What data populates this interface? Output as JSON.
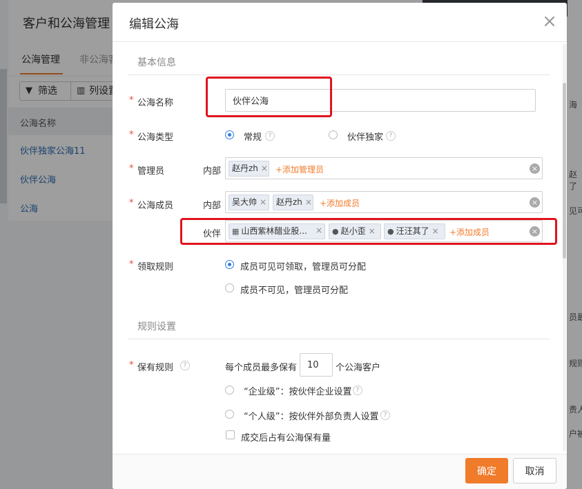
{
  "background": {
    "title": "客户和公海管理",
    "tabs": [
      "公海管理",
      "非公海客"
    ],
    "toolbar": {
      "filter": "筛选",
      "columns": "列设置"
    },
    "table_header": "公海名称",
    "rows": [
      "伙伴独家公海11",
      "伙伴公海",
      "公海"
    ],
    "right_fragments": [
      "海",
      "赵",
      "了",
      "见可",
      "员最",
      "规则",
      "责人",
      "户被"
    ]
  },
  "dialog": {
    "title": "编辑公海",
    "close_icon": "close-icon",
    "sections": {
      "basic": "基本信息",
      "rules": "规则设置"
    },
    "pool_name": {
      "label": "公海名称",
      "value": "伙伴公海"
    },
    "pool_type": {
      "label": "公海类型",
      "options": [
        "常规",
        "伙伴独家"
      ],
      "selected": "常规"
    },
    "admin": {
      "label": "管理员",
      "internal_label": "内部",
      "tags": [
        "赵丹zh"
      ],
      "add": "+添加管理员"
    },
    "members": {
      "label": "公海成员",
      "internal_label": "内部",
      "internal_tags": [
        "吴大帅",
        "赵丹zh"
      ],
      "internal_add": "+添加成员",
      "partner_label": "伙伴",
      "partner_tags": [
        {
          "text": "山西紫林醋业股...",
          "icon": "building-icon"
        },
        {
          "text": "赵小歪",
          "icon": "person-icon"
        },
        {
          "text": "汪汪其了",
          "icon": "person-icon"
        }
      ],
      "partner_add": "+添加成员"
    },
    "claim_rule": {
      "label": "领取规则",
      "options": [
        "成员可见可领取，管理员可分配",
        "成员不可见，管理员可分配"
      ],
      "selected": "成员可见可领取，管理员可分配"
    },
    "retain_rule": {
      "label": "保有规则",
      "prefix": "每个成员最多保有",
      "value": "10",
      "suffix": "个公海客户",
      "options": [
        "“企业级”：按伙伴企业设置",
        "“个人级”：按伙伴外部负责人设置"
      ],
      "checkbox": "成交后占有公海保有量"
    },
    "buttons": {
      "ok": "确定",
      "cancel": "取消"
    },
    "highlight_color": "#e0131f",
    "accent_color": "#f07b2b"
  }
}
